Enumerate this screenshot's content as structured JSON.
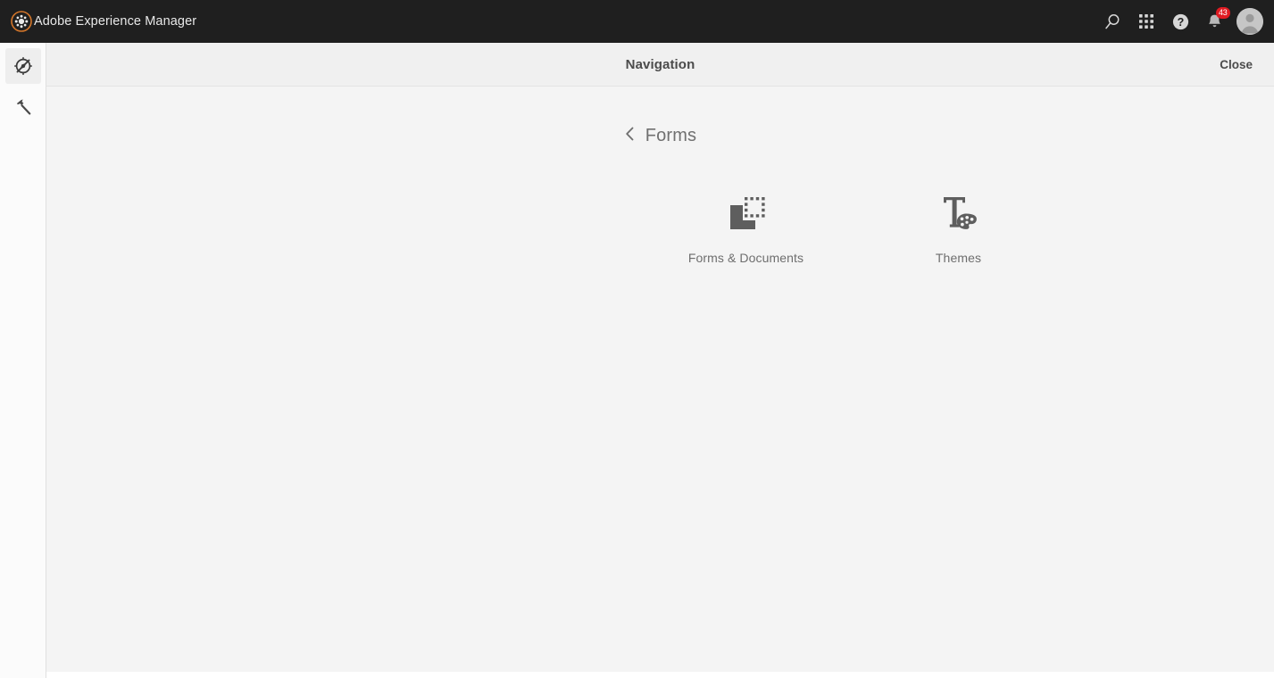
{
  "topbar": {
    "brand_label": "Adobe Experience Manager",
    "logo_icon": "adobe-experience-manager-logo",
    "background": "#1f1f1f",
    "actions": [
      {
        "name": "search-icon",
        "label": "Search"
      },
      {
        "name": "solutions-grid-icon",
        "label": "Solutions"
      },
      {
        "name": "help-icon",
        "label": "Help"
      },
      {
        "name": "notifications-bell-icon",
        "label": "Notifications",
        "badge": "43",
        "badge_color": "#e01b22"
      },
      {
        "name": "user-avatar",
        "label": "User"
      }
    ]
  },
  "rail": {
    "items": [
      {
        "name": "navigation-compass-icon",
        "label": "Navigation",
        "active": true
      },
      {
        "name": "tools-hammer-icon",
        "label": "Tools",
        "active": false
      }
    ]
  },
  "panel": {
    "title": "Navigation",
    "close_label": "Close"
  },
  "breadcrumb": {
    "back_icon": "chevron-left-icon",
    "label": "Forms"
  },
  "tiles": [
    {
      "label": "Forms & Documents",
      "icon": "forms-and-documents-icon"
    },
    {
      "label": "Themes",
      "icon": "themes-palette-icon"
    }
  ],
  "colors": {
    "topbar_bg": "#1f1f1f",
    "rail_bg": "#fbfbfb",
    "panel_header_bg": "#f0f0f0",
    "content_bg": "#f4f4f4",
    "icon_gray": "#5e5e5e",
    "text_gray": "#6e6e6e",
    "brand_orange": "#d4762a",
    "badge_red": "#e01b22"
  }
}
